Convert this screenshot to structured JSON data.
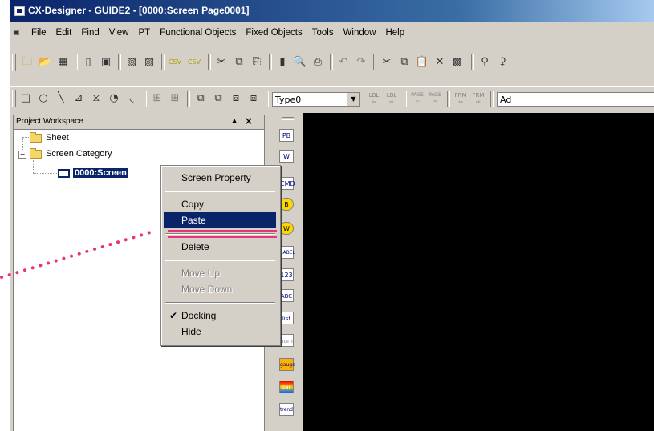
{
  "window": {
    "title": "CX-Designer - GUIDE2 - [0000:Screen Page0001]"
  },
  "menubar": {
    "items": [
      "File",
      "Edit",
      "Find",
      "View",
      "PT",
      "Functional Objects",
      "Fixed Objects",
      "Tools",
      "Window",
      "Help"
    ]
  },
  "toolbar2": {
    "type_combo_value": "Type0",
    "partial_combo_value": "Ad"
  },
  "toolbar2_labels": {
    "lbl1": "LBL",
    "lbl2": "LBL",
    "page1": "PAGE",
    "page2": "PAGE",
    "frm1": "FRM",
    "frm2": "FRM"
  },
  "workspace": {
    "title": "Project Workspace",
    "pin": "▲",
    "close": "×",
    "tree": {
      "sheet": "Sheet",
      "screen_category": "Screen Category",
      "screen_page": "0000:Screen"
    }
  },
  "object_strip": {
    "icons": [
      "PB",
      "W",
      "CMD",
      "B",
      "W",
      "LABEL",
      "123",
      "ABC",
      "list",
      "num",
      "gauge",
      "bar",
      "trend"
    ]
  },
  "context_menu": {
    "screen_property": "Screen Property",
    "copy": "Copy",
    "paste": "Paste",
    "delete": "Delete",
    "move_up": "Move Up",
    "move_down": "Move Down",
    "docking": "Docking",
    "hide": "Hide",
    "docking_checked": true,
    "highlighted": "Paste"
  },
  "colors": {
    "title_blue": "#0a246a",
    "annotation_pink": "#e8327a",
    "canvas": "#000000"
  }
}
